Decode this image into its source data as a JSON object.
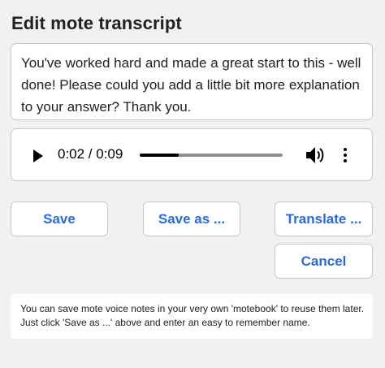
{
  "dialog": {
    "title": "Edit mote transcript"
  },
  "transcript": {
    "text": "You've worked hard and made a great start to this - well done! Please could you add a little bit more explanation to your answer? Thank you."
  },
  "player": {
    "time_display": "0:02 / 0:09",
    "progress_fraction": 0.27,
    "icons": {
      "play": "play-icon",
      "volume": "volume-icon",
      "menu": "more-vert-icon"
    }
  },
  "buttons": {
    "save": "Save",
    "save_as": "Save as ...",
    "translate": "Translate ...",
    "cancel": "Cancel"
  },
  "help": {
    "line1": "You can save mote voice notes in your very own 'motebook' to reuse them later.",
    "line2": "Just click 'Save as ...' above and enter an easy to remember name."
  },
  "colors": {
    "accent": "#2b6bd9",
    "background": "#f1f1f1",
    "text": "#202124"
  }
}
